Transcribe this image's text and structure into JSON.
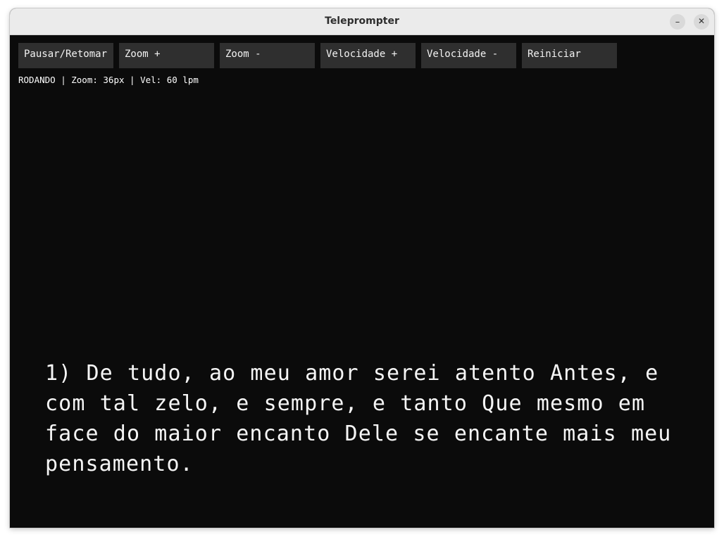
{
  "window": {
    "title": "Teleprompter",
    "minimize_glyph": "–",
    "close_glyph": "✕"
  },
  "toolbar": {
    "buttons": [
      {
        "label": "Pausar/Retomar"
      },
      {
        "label": "Zoom +"
      },
      {
        "label": "Zoom -"
      },
      {
        "label": "Velocidade +"
      },
      {
        "label": "Velocidade -"
      },
      {
        "label": "Reiniciar"
      }
    ]
  },
  "status": {
    "text": "RODANDO | Zoom: 36px | Vel: 60 lpm"
  },
  "script": {
    "text": "1) De tudo, ao meu amor serei atento Antes, e com tal zelo, e sempre, e tanto Que mesmo em face do maior encanto Dele se encante mais meu pensamento."
  },
  "colors": {
    "background": "#0b0b0b",
    "button": "#2f2f2f",
    "text": "#f5f5f5",
    "titlebar": "#ebebeb"
  },
  "icons": [
    "minimize-icon",
    "close-icon"
  ]
}
